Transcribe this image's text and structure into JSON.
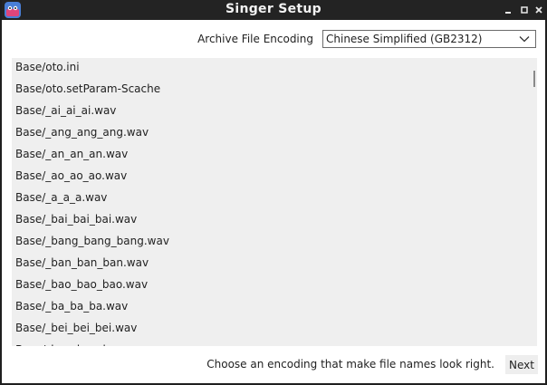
{
  "window": {
    "title": "Singer Setup"
  },
  "encoding": {
    "label": "Archive File Encoding",
    "selected": "Chinese Simplified (GB2312)"
  },
  "files": [
    "Base/oto.ini",
    "Base/oto.setParam-Scache",
    "Base/_ai_ai_ai.wav",
    "Base/_ang_ang_ang.wav",
    "Base/_an_an_an.wav",
    "Base/_ao_ao_ao.wav",
    "Base/_a_a_a.wav",
    "Base/_bai_bai_bai.wav",
    "Base/_bang_bang_bang.wav",
    "Base/_ban_ban_ban.wav",
    "Base/_bao_bao_bao.wav",
    "Base/_ba_ba_ba.wav",
    "Base/_bei_bei_bei.wav",
    "Base/_ben_ben_ben.wav"
  ],
  "footer": {
    "hint": "Choose an encoding that make file names look right.",
    "next_label": "Next"
  },
  "colors": {
    "titlebar": "#232323",
    "list_bg": "#efefef",
    "icon_bg": "#4a7fd6",
    "icon_accent": "#e0457b"
  }
}
